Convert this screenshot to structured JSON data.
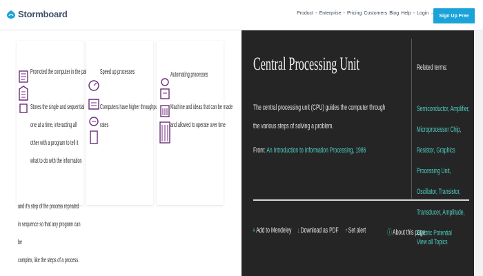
{
  "header": {
    "brand": "Stormboard",
    "nav": {
      "product": "Product",
      "enterprise": "Enterprise",
      "pricing": "Pricing",
      "customers": "Customers",
      "blog": "Blog",
      "help": "Help",
      "login": "Login",
      "login_arrow": "→"
    },
    "signup_label": "Sign Up Free"
  },
  "cards": [
    {
      "title": "Promoted the computer in the pattern",
      "text_lines": [
        "Stores the single and sequential",
        "one at a time, interacting all",
        "other with a program to tell it",
        "what to do with the information"
      ],
      "overflow_lines": [
        "and it's step of the process repeated",
        "in sequence so that any program can be",
        "complex, like the steps of a process."
      ]
    },
    {
      "title": "Speed up processes",
      "text_lines": [
        "Computers have higher throughput",
        "rates"
      ]
    },
    {
      "title": "Automating processes",
      "text_lines": [
        "Machine and ideas that can be made",
        "and allowed to operate over time"
      ]
    }
  ],
  "concept": {
    "title": "Central Processing Unit",
    "body": "The central processing unit (CPU) guides the computer through the various steps of solving a problem.",
    "from_prefix": "From:",
    "from_link": "An Introduction to Information Processing, 1986",
    "actions": {
      "add": "Add to Mendeley",
      "download": "Download as PDF",
      "set_alert": "Set alert"
    },
    "about": "About this page",
    "action_icons": {
      "add": "+",
      "download": "↓",
      "alert": "◔",
      "about": "ⓘ"
    }
  },
  "related": {
    "heading": "Related terms:",
    "terms_text": "Semiconductor, Amplifier, Microprocessor Chip, Resistor, Graphics Processing Unit, Oscillator, Transistor, Transducer, Amplitude, Electric Potential",
    "view_topics": "View all Topics"
  },
  "colors": {
    "accent_teal": "#4fd0c0",
    "signup_blue": "#1aa3d8",
    "dark_panel": "#252526",
    "icon_purple": "#6b2d7a"
  }
}
